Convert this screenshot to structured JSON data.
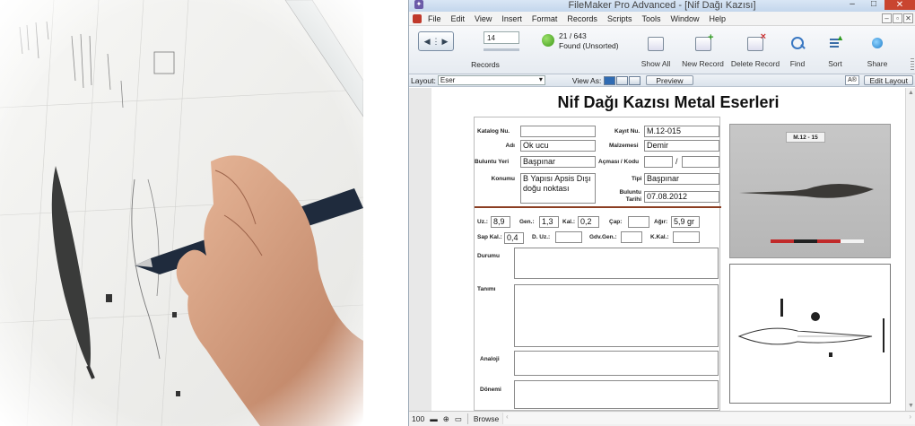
{
  "window": {
    "title": "FileMaker Pro Advanced - [Nif Dağı Kazısı]"
  },
  "menubar": [
    "File",
    "Edit",
    "View",
    "Insert",
    "Format",
    "Records",
    "Scripts",
    "Tools",
    "Window",
    "Help"
  ],
  "toolbar": {
    "record_number": "14",
    "records_label": "Records",
    "found_count": "21 / 643",
    "found_status": "Found (Unsorted)",
    "show_all": "Show All",
    "new_record": "New Record",
    "delete_record": "Delete Record",
    "find": "Find",
    "sort": "Sort",
    "share": "Share"
  },
  "layoutbar": {
    "layout_label": "Layout:",
    "layout_value": "Eser",
    "view_as": "View As:",
    "preview": "Preview",
    "aa": "A®",
    "edit_layout": "Edit Layout"
  },
  "form": {
    "title": "Nif Dağı Kazısı Metal Eserleri",
    "katalog_label": "Katalog Nu.",
    "katalog_value": "",
    "kayit_label": "Kayıt Nu.",
    "kayit_value": "M.12-015",
    "adi_label": "Adı",
    "adi_value": "Ok ucu",
    "malzeme_label": "Malzemesi",
    "malzeme_value": "Demir",
    "buluntu_yeri_label": "Buluntu Yeri",
    "buluntu_yeri_value": "Başpınar",
    "acmasi_label": "Açması / Kodu",
    "acmasi_value1": "",
    "acmasi_value2": "/",
    "konumu_label": "Konumu",
    "konumu_value": "B Yapısı Apsis Dışı doğu noktası",
    "tipi_label": "Tipi",
    "tipi_value": "Başpınar",
    "tarih_label": "Buluntu Tarihi",
    "tarih_value": "07.08.2012",
    "uz_label": "Uz.:",
    "uz_value": "8,9",
    "gen_label": "Gen.:",
    "gen_value": "1,3",
    "kal_label": "Kal.:",
    "kal_value": "0,2",
    "cap_label": "Çap:",
    "cap_value": "",
    "agir_label": "Ağır:",
    "agir_value": "5,9 gr",
    "sap_label": "Sap Kal.:",
    "sap_value": "0,4",
    "duz_label": "D. Uz.:",
    "duz_value": "",
    "gov_label": "Gdv.Gen.:",
    "gov_value": "",
    "kkal_label": "K.Kal.:",
    "kkal_value": "",
    "durumu_label": "Durumu",
    "tanimi_label": "Tanımı",
    "analoji_label": "Analoji",
    "donemi_label": "Dönemi",
    "photo_tag": "M.12 - 15"
  },
  "statusbar": {
    "zoom": "100",
    "mode": "Browse"
  }
}
